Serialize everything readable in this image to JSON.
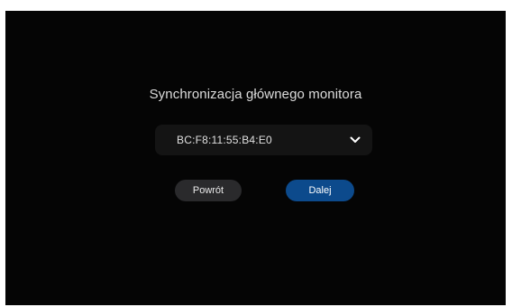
{
  "dialog": {
    "title": "Synchronizacja głównego monitora",
    "monitor_select": {
      "selected_value": "BC:F8:11:55:B4:E0"
    },
    "back_button_label": "Powrót",
    "next_button_label": "Dalej"
  },
  "colors": {
    "background": "#050505",
    "select_background": "#141414",
    "back_button": "#2a2a2c",
    "next_button": "#0c4a8c"
  },
  "icons": {
    "dropdown": "chevron-down-icon"
  }
}
